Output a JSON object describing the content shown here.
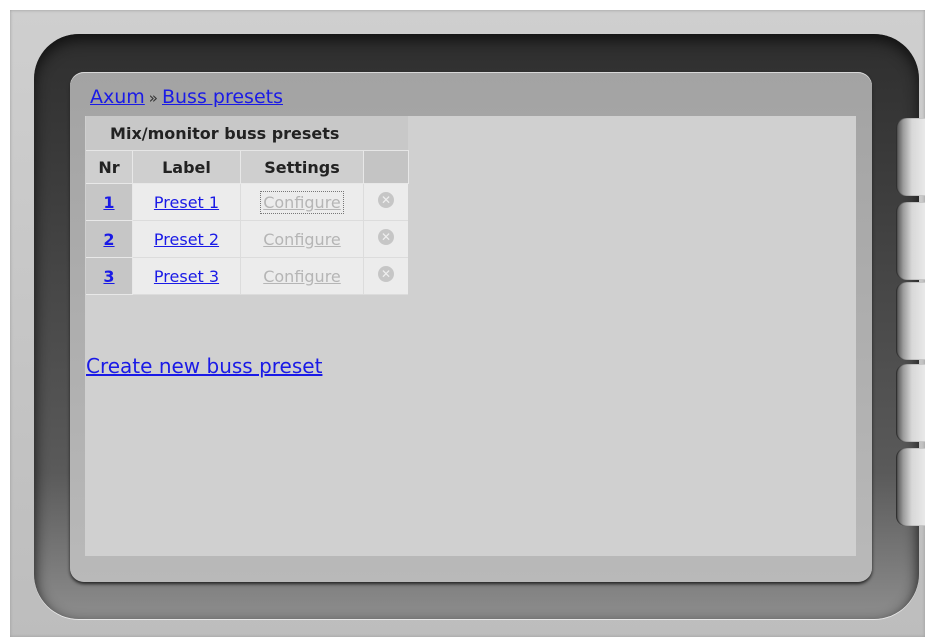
{
  "breadcrumb": {
    "home": "Axum",
    "separator": "»",
    "current": "Buss presets"
  },
  "table": {
    "title": "Mix/monitor buss presets",
    "columns": [
      "Nr",
      "Label",
      "Settings",
      ""
    ],
    "rows": [
      {
        "nr": "1",
        "label": "Preset 1",
        "settings": "Configure",
        "delete_icon": "remove-circle-icon"
      },
      {
        "nr": "2",
        "label": "Preset 2",
        "settings": "Configure",
        "delete_icon": "remove-circle-icon"
      },
      {
        "nr": "3",
        "label": "Preset 3",
        "settings": "Configure",
        "delete_icon": "remove-circle-icon"
      }
    ]
  },
  "actions": {
    "create": "Create new buss preset"
  },
  "colors": {
    "link": "#1a1ae6",
    "disabled_link": "#b5b5b5",
    "content_bg": "#d0d0d0"
  }
}
